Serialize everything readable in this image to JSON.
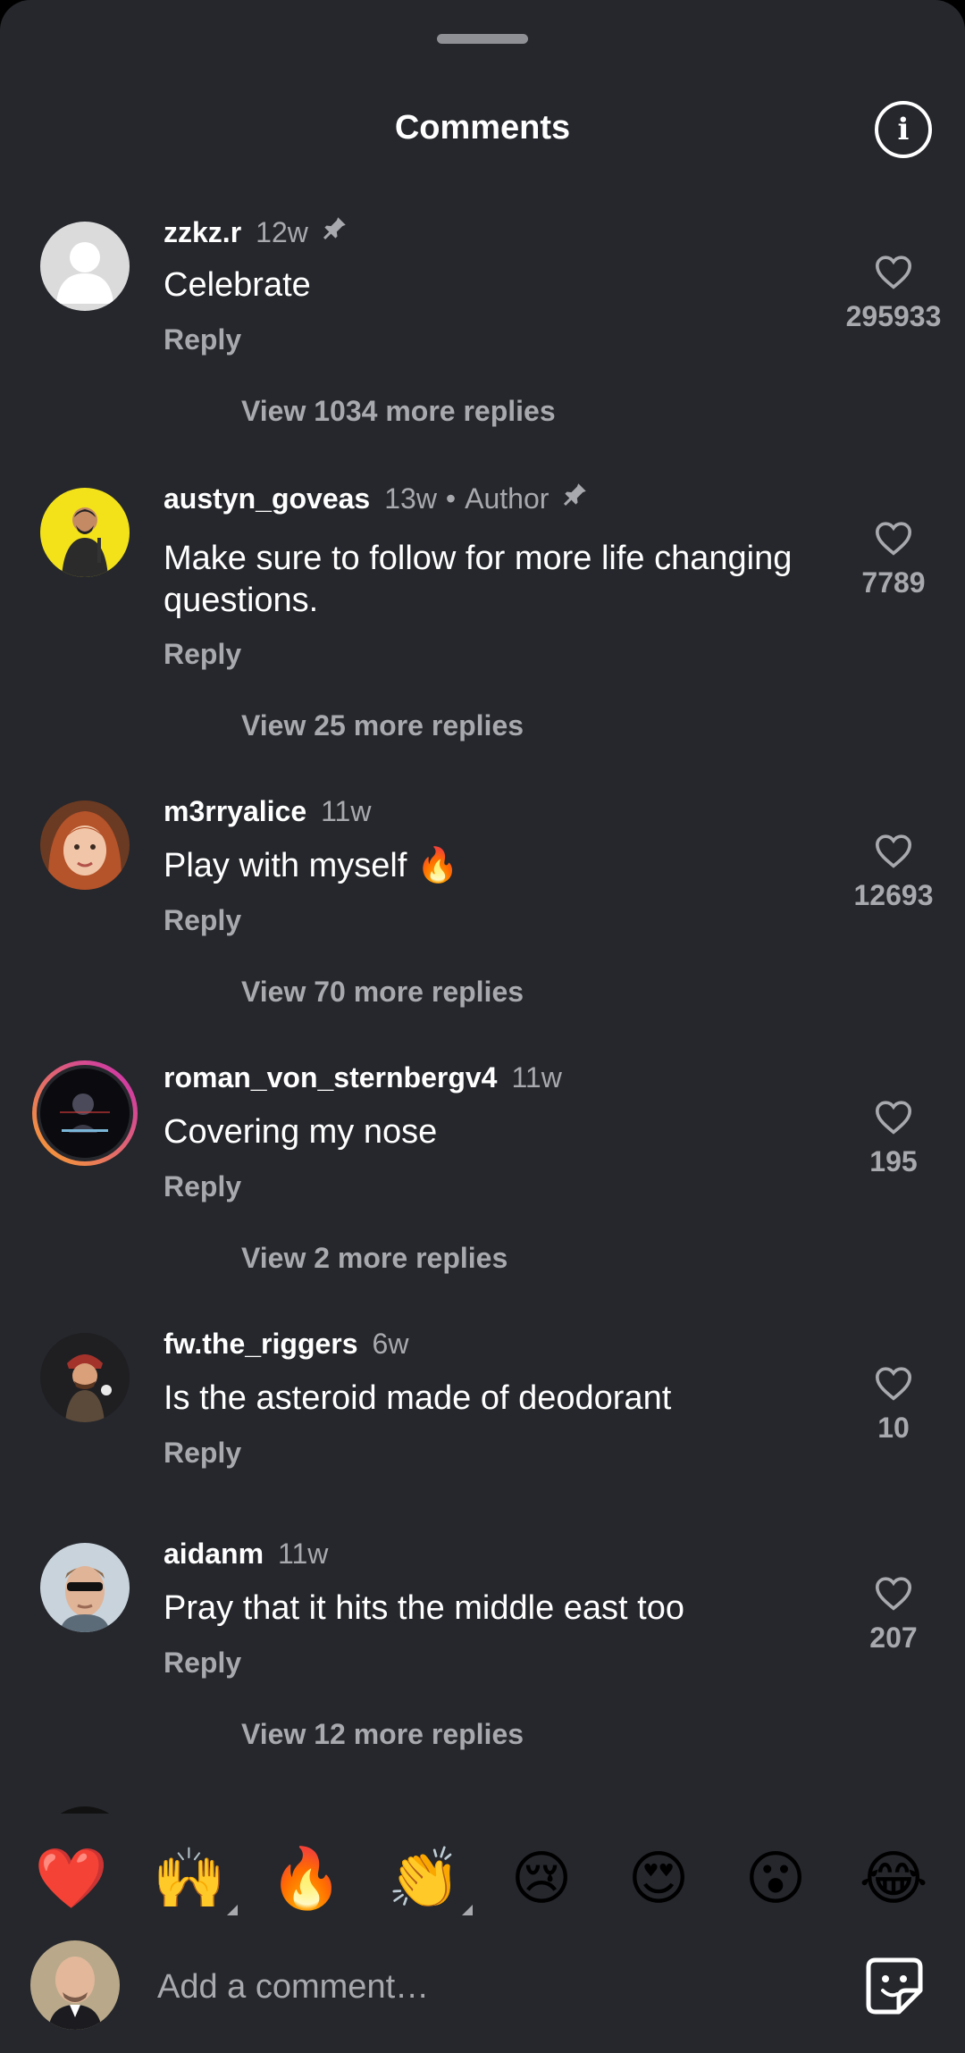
{
  "header": {
    "title": "Comments",
    "info_icon": "info-icon"
  },
  "comments": [
    {
      "username": "zzkz.r",
      "time": "12w",
      "pinned": true,
      "author_tag": "",
      "text": "Celebrate",
      "reply_label": "Reply",
      "likes": "295933",
      "view_replies": "View 1034 more replies"
    },
    {
      "username": "austyn_goveas",
      "time": "13w",
      "pinned": true,
      "author_tag": "Author",
      "text": "Make sure to follow for more life changing questions.",
      "reply_label": "Reply",
      "likes": "7789",
      "view_replies": "View 25 more replies"
    },
    {
      "username": "m3rryalice",
      "time": "11w",
      "pinned": false,
      "author_tag": "",
      "text": "Play with myself 🔥",
      "reply_label": "Reply",
      "likes": "12693",
      "view_replies": "View 70 more replies"
    },
    {
      "username": "roman_von_sternbergv4",
      "time": "11w",
      "pinned": false,
      "author_tag": "",
      "text": "Covering my nose",
      "reply_label": "Reply",
      "likes": "195",
      "view_replies": "View 2 more replies"
    },
    {
      "username": "fw.the_riggers",
      "time": "6w",
      "pinned": false,
      "author_tag": "",
      "text": "Is the asteroid made of deodorant",
      "reply_label": "Reply",
      "likes": "10",
      "view_replies": ""
    },
    {
      "username": "aidanm",
      "time": "11w",
      "pinned": false,
      "author_tag": "",
      "text": "Pray that it hits the middle east too",
      "reply_label": "Reply",
      "likes": "207",
      "view_replies": "View 12 more replies"
    }
  ],
  "reactions": [
    "❤️",
    "🙌",
    "🔥",
    "👏",
    "😢",
    "😍",
    "😮",
    "😂"
  ],
  "composer": {
    "placeholder": "Add a comment…",
    "sticker_icon": "sticker-icon"
  },
  "colors": {
    "background": "#25272c",
    "primary_text": "#ffffff",
    "secondary_text": "#a7a9ae",
    "story_ring_start": "#f9a22a",
    "story_ring_end": "#c92bb5"
  }
}
